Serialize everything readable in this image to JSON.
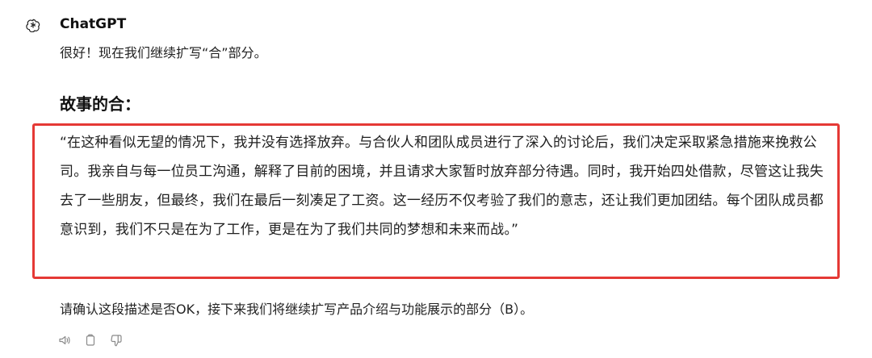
{
  "message": {
    "sender": "ChatGPT",
    "intro": "很好！现在我们继续扩写“合”部分。",
    "section_title": "故事的合：",
    "story_paragraph": "“在这种看似无望的情况下，我并没有选择放弃。与合伙人和团队成员进行了深入的讨论后，我们决定采取紧急措施来挽救公司。我亲自与每一位员工沟通，解释了目前的困境，并且请求大家暂时放弃部分待遇。同时，我开始四处借款，尽管这让我失去了一些朋友，但最终，我们在最后一刻凑足了工资。这一经历不仅考验了我们的意志，还让我们更加团结。每个团队成员都意识到，我们不只是在为了工作，更是在为了我们共同的梦想和未来而战。”",
    "confirm": "请确认这段描述是否OK，接下来我们将继续扩写产品介绍与功能展示的部分（B）。"
  },
  "highlight_color": "#e53935",
  "icons": {
    "avatar": "openai-logo-icon",
    "actions": [
      "read-aloud-icon",
      "copy-icon",
      "thumbs-down-icon"
    ]
  }
}
